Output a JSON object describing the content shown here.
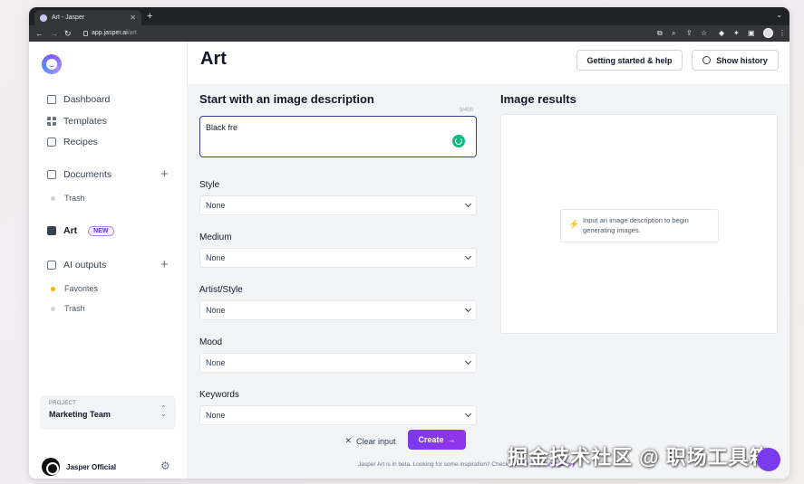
{
  "browser": {
    "tab_title": "Art - Jasper",
    "url_domain": "app.jasper.ai",
    "url_path": "/art"
  },
  "sidebar": {
    "items": [
      {
        "label": "Dashboard",
        "icon": "home-icon"
      },
      {
        "label": "Templates",
        "icon": "grid-icon"
      },
      {
        "label": "Recipes",
        "icon": "recipe-icon"
      }
    ],
    "documents": {
      "label": "Documents",
      "sub": [
        {
          "label": "Trash"
        }
      ]
    },
    "art": {
      "label": "Art",
      "badge": "NEW"
    },
    "ai_outputs": {
      "label": "AI outputs",
      "sub": [
        {
          "label": "Favorites"
        },
        {
          "label": "Trash"
        }
      ]
    },
    "project": {
      "label": "PROJECT",
      "name": "Marketing Team"
    },
    "user": {
      "name": "Jasper Official"
    }
  },
  "header": {
    "title": "Art",
    "help_button": "Getting started & help",
    "history_button": "Show history"
  },
  "form": {
    "title": "Start with an image description",
    "counter": "9/400",
    "description_value": "Black fre",
    "fields": [
      {
        "label": "Style",
        "value": "None"
      },
      {
        "label": "Medium",
        "value": "None"
      },
      {
        "label": "Artist/Style",
        "value": "None"
      },
      {
        "label": "Mood",
        "value": "None"
      },
      {
        "label": "Keywords",
        "value": "None"
      }
    ],
    "clear_button": "Clear input",
    "create_button": "Create",
    "beta_note": "Jasper Art is in beta. Looking for some inspiration? Check out the",
    "beta_link": "Jasper Art gallery"
  },
  "results": {
    "title": "Image results",
    "hint": "Input an image description to begin generating images."
  },
  "watermark": "掘金技术社区 @ 职场工具箱",
  "colors": {
    "accent": "#7c3aed",
    "focus_border": "#3b3f8f",
    "spinner": "#10b981"
  }
}
